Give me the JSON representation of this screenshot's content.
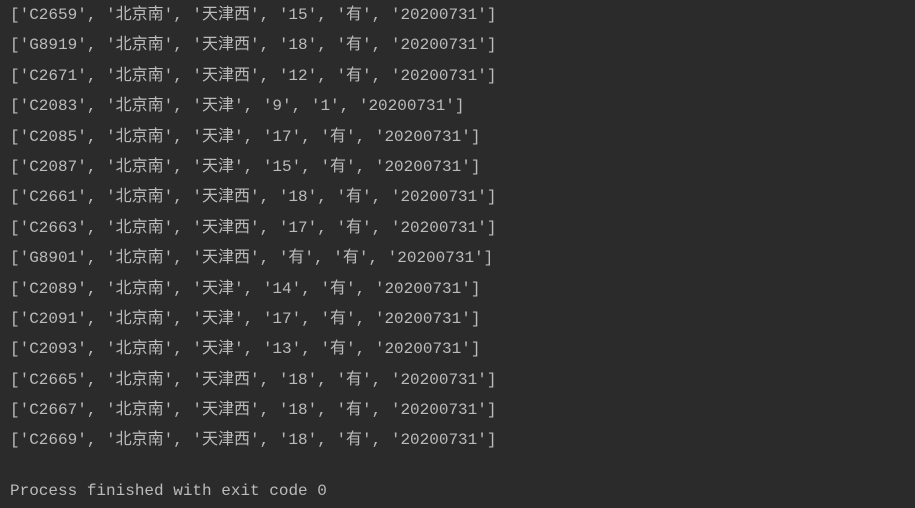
{
  "output": {
    "rows": [
      {
        "items": [
          "C2659",
          "北京南",
          "天津西",
          "15",
          "有",
          "20200731"
        ]
      },
      {
        "items": [
          "G8919",
          "北京南",
          "天津西",
          "18",
          "有",
          "20200731"
        ]
      },
      {
        "items": [
          "C2671",
          "北京南",
          "天津西",
          "12",
          "有",
          "20200731"
        ]
      },
      {
        "items": [
          "C2083",
          "北京南",
          "天津",
          "9",
          "1",
          "20200731"
        ]
      },
      {
        "items": [
          "C2085",
          "北京南",
          "天津",
          "17",
          "有",
          "20200731"
        ]
      },
      {
        "items": [
          "C2087",
          "北京南",
          "天津",
          "15",
          "有",
          "20200731"
        ]
      },
      {
        "items": [
          "C2661",
          "北京南",
          "天津西",
          "18",
          "有",
          "20200731"
        ]
      },
      {
        "items": [
          "C2663",
          "北京南",
          "天津西",
          "17",
          "有",
          "20200731"
        ]
      },
      {
        "items": [
          "G8901",
          "北京南",
          "天津西",
          "有",
          "有",
          "20200731"
        ]
      },
      {
        "items": [
          "C2089",
          "北京南",
          "天津",
          "14",
          "有",
          "20200731"
        ]
      },
      {
        "items": [
          "C2091",
          "北京南",
          "天津",
          "17",
          "有",
          "20200731"
        ]
      },
      {
        "items": [
          "C2093",
          "北京南",
          "天津",
          "13",
          "有",
          "20200731"
        ]
      },
      {
        "items": [
          "C2665",
          "北京南",
          "天津西",
          "18",
          "有",
          "20200731"
        ]
      },
      {
        "items": [
          "C2667",
          "北京南",
          "天津西",
          "18",
          "有",
          "20200731"
        ]
      },
      {
        "items": [
          "C2669",
          "北京南",
          "天津西",
          "18",
          "有",
          "20200731"
        ]
      }
    ]
  },
  "status": {
    "message": "Process finished with exit code 0"
  }
}
